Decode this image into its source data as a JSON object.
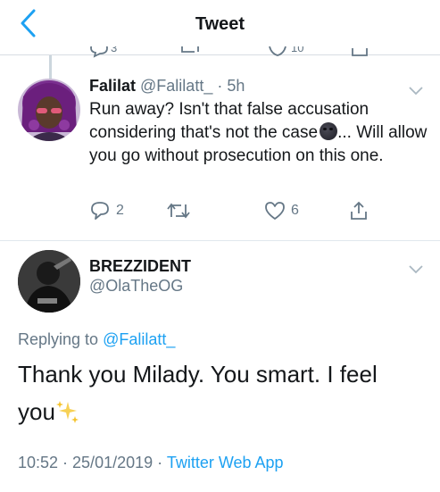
{
  "header": {
    "title": "Tweet"
  },
  "prev_tweet": {
    "reply_count": "3",
    "like_count": "10"
  },
  "tweet1": {
    "name": "Falilat",
    "handle": "@Falilatt_",
    "separator": " · ",
    "time": "5h",
    "text_before": "Run away? Isn't that false accusation considering that's not the case",
    "text_after": "... Will allow you go without prosecution on this one.",
    "emoji": "new-moon-face-emoji",
    "reply_count": "2",
    "like_count": "6"
  },
  "tweet2": {
    "name": "BREZZIDENT",
    "handle": "@OlaTheOG",
    "replying_label": "Replying to",
    "replying_to": "@Falilatt_",
    "text": "Thank you Milady. You smart. I feel you",
    "emoji": "sparkles-emoji",
    "timestamp": "10:52 · 25/01/2019 · ",
    "source": "Twitter Web App"
  },
  "colors": {
    "accent": "#1da1f2",
    "secondary_text": "#657786",
    "divider": "#e1e8ed"
  }
}
